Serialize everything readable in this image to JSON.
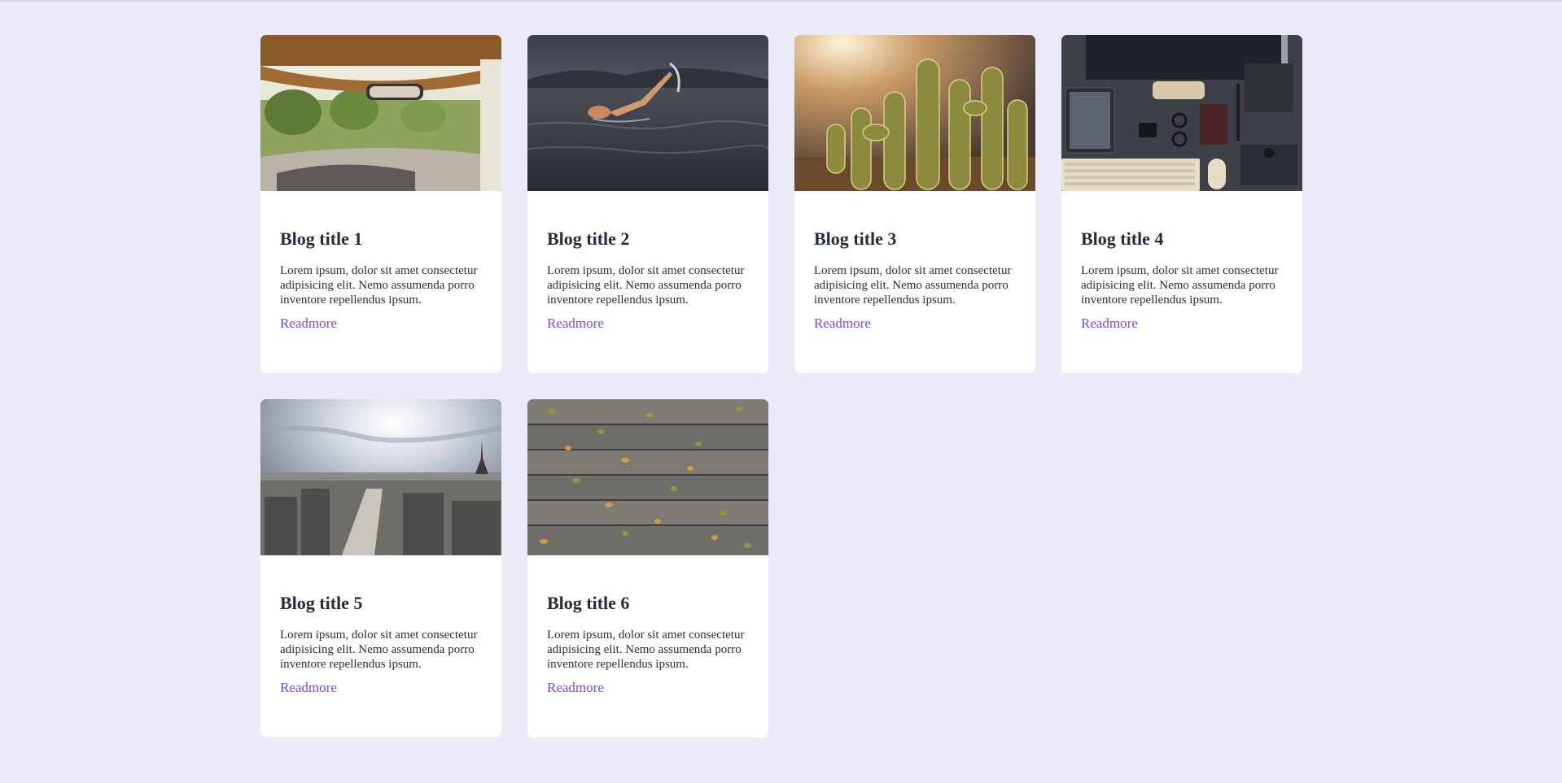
{
  "colors": {
    "background": "#ebeaf8",
    "card": "#ffffff",
    "title": "#1f2d3d",
    "text": "#2a2f3a",
    "link": "#7a47e0"
  },
  "posts": [
    {
      "title": "Blog title 1",
      "excerpt": "Lorem ipsum, dolor sit amet consectetur adipisicing elit. Nemo assumenda porro inventore repellendus ipsum.",
      "link": "Readmore",
      "image": "car-interior-photo"
    },
    {
      "title": "Blog title 2",
      "excerpt": "Lorem ipsum, dolor sit amet consectetur adipisicing elit. Nemo assumenda porro inventore repellendus ipsum.",
      "link": "Readmore",
      "image": "swimmer-photo"
    },
    {
      "title": "Blog title 3",
      "excerpt": "Lorem ipsum, dolor sit amet consectetur adipisicing elit. Nemo assumenda porro inventore repellendus ipsum.",
      "link": "Readmore",
      "image": "cactus-photo"
    },
    {
      "title": "Blog title 4",
      "excerpt": "Lorem ipsum, dolor sit amet consectetur adipisicing elit. Nemo assumenda porro inventore repellendus ipsum.",
      "link": "Readmore",
      "image": "desk-flatlay-photo"
    },
    {
      "title": "Blog title 5",
      "excerpt": "Lorem ipsum, dolor sit amet consectetur adipisicing elit. Nemo assumenda porro inventore repellendus ipsum.",
      "link": "Readmore",
      "image": "city-skyline-photo"
    },
    {
      "title": "Blog title 6",
      "excerpt": "Lorem ipsum, dolor sit amet consectetur adipisicing elit. Nemo assumenda porro inventore repellendus ipsum.",
      "link": "Readmore",
      "image": "wood-leaves-photo"
    }
  ]
}
